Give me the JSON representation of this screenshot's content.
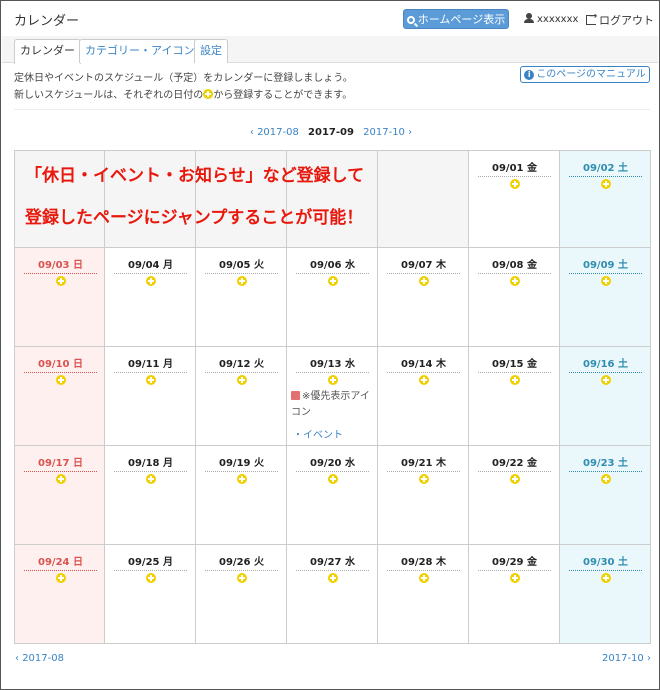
{
  "header": {
    "title": "カレンダー",
    "homepage_button": "ホームページ表示",
    "username": "xxxxxxx",
    "logout": "ログアウト"
  },
  "tabs": [
    {
      "label": "カレンダー",
      "active": true
    },
    {
      "label": "カテゴリー・アイコン",
      "active": false
    },
    {
      "label": "設定",
      "active": false
    }
  ],
  "description": {
    "line1": "定休日やイベントのスケジュール（予定）をカレンダーに登録しましょう。",
    "line2_before": "新しいスケジュールは、それぞれの日付の",
    "line2_after": "から登録することができます。"
  },
  "manual_button": "このページのマニュアル",
  "month_nav": {
    "prev": "2017-08",
    "current": "2017-09",
    "next": "2017-10"
  },
  "overlay": {
    "line1": "「休日・イベント・お知らせ」など登録して",
    "line2": "登録したページにジャンプすることが可能！"
  },
  "calendar": {
    "weeks": [
      [
        "",
        "",
        "",
        "",
        "",
        "09/01 金",
        "09/02 土"
      ],
      [
        "09/03 日",
        "09/04 月",
        "09/05 火",
        "09/06 水",
        "09/07 木",
        "09/08 金",
        "09/09 土"
      ],
      [
        "09/10 日",
        "09/11 月",
        "09/12 火",
        "09/13 水",
        "09/14 木",
        "09/15 金",
        "09/16 土"
      ],
      [
        "09/17 日",
        "09/18 月",
        "09/19 火",
        "09/20 水",
        "09/21 木",
        "09/22 金",
        "09/23 土"
      ],
      [
        "09/24 日",
        "09/25 月",
        "09/26 火",
        "09/27 水",
        "09/28 木",
        "09/29 金",
        "09/30 土"
      ]
    ],
    "events": {
      "09/13 水": {
        "priority_text": "※優先表示アイコン",
        "event_link": "・イベント"
      }
    }
  },
  "bottom_nav": {
    "prev": "2017-08",
    "next": "2017-10"
  },
  "colors": {
    "accent": "#3a84c5",
    "sunday": "#d9534f",
    "saturday": "#2f8db0",
    "add": "#f0d000",
    "overlay": "#e8180c"
  }
}
